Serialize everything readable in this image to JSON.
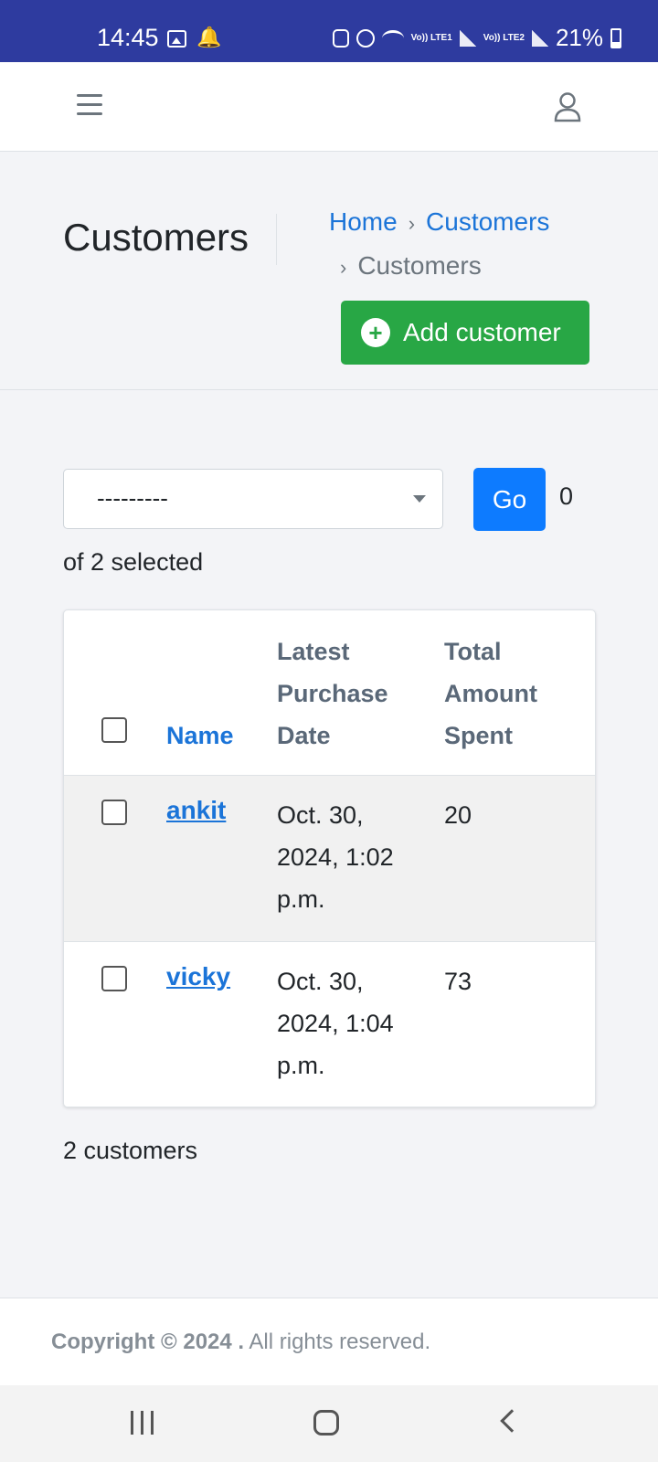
{
  "status_bar": {
    "time": "14:45",
    "sim1": "Vo)) LTE1",
    "sim2": "Vo)) LTE2",
    "battery": "21%"
  },
  "header": {
    "title": "Customers",
    "breadcrumb": [
      "Home",
      "Customers",
      "Customers"
    ],
    "add_button": "Add customer"
  },
  "actions": {
    "select_value": "---------",
    "go_label": "Go",
    "selected_count": "0",
    "of_selected": "of 2 selected"
  },
  "table": {
    "columns": [
      "Name",
      "Latest Purchase Date",
      "Total Amount Spent"
    ],
    "rows": [
      {
        "name": "ankit",
        "date": "Oct. 30, 2024, 1:02 p.m.",
        "total": "20"
      },
      {
        "name": "vicky",
        "date": "Oct. 30, 2024, 1:04 p.m.",
        "total": "73"
      }
    ]
  },
  "result_count": "2 customers",
  "footer": {
    "copyright_bold": "Copyright © 2024 .",
    "copyright_rest": "All rights reserved."
  },
  "colors": {
    "status_bar": "#2e3b9f",
    "primary": "#0d7bff",
    "success": "#28a745",
    "link": "#1b74d8"
  }
}
